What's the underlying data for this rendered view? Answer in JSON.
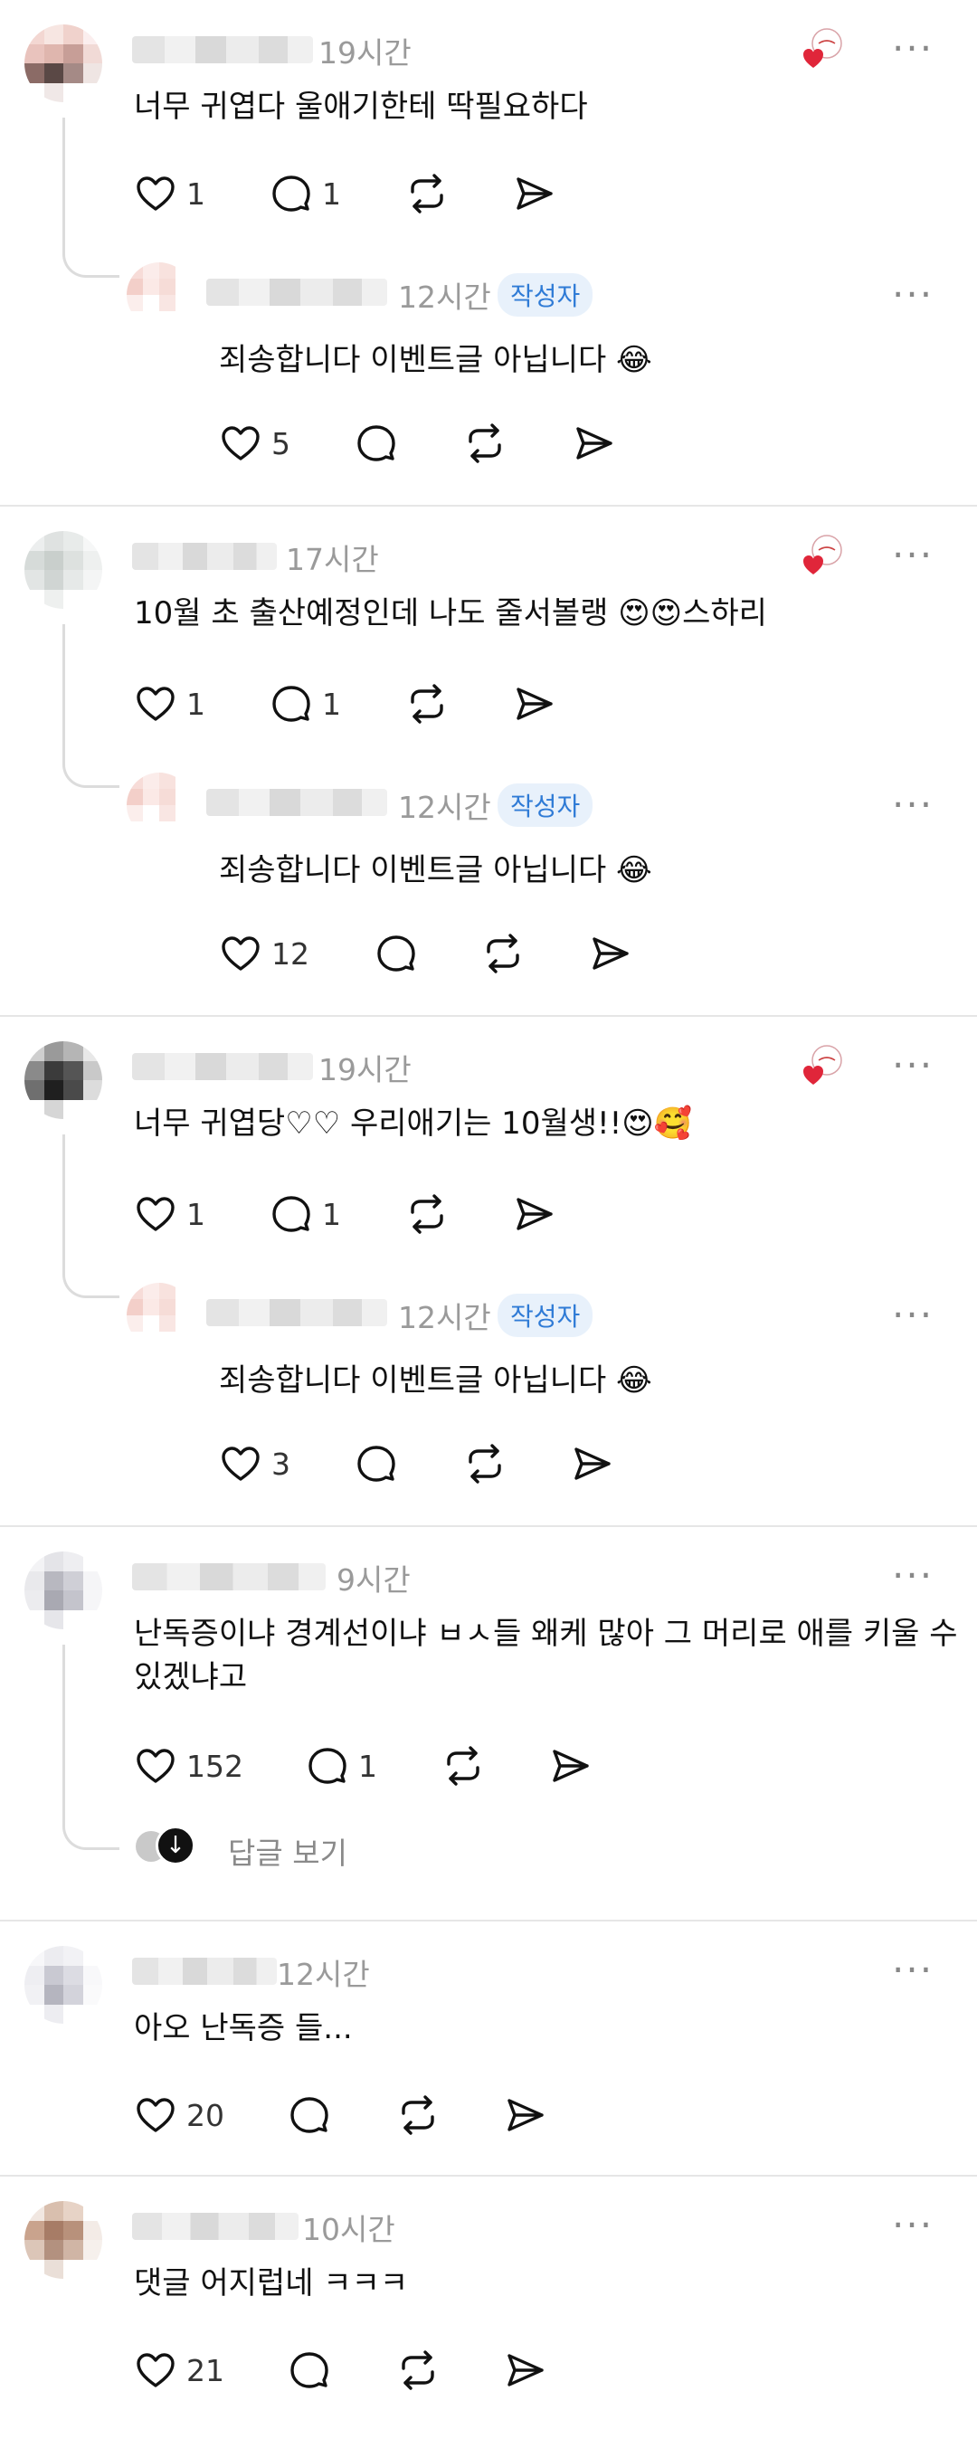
{
  "threads": [
    {
      "comment": {
        "time": "19시간",
        "text": "너무 귀엽다 울애기한테 딱필요하다",
        "likes": "1",
        "replies": "1"
      },
      "reply": {
        "time": "12시간",
        "badge": "작성자",
        "text": "죄송합니다  이벤트글 아닙니다 😂",
        "likes": "5"
      }
    },
    {
      "comment": {
        "time": "17시간",
        "text": "10월 초 출산예정인데 나도 줄서볼랭 😍😍스하리",
        "likes": "1",
        "replies": "1"
      },
      "reply": {
        "time": "12시간",
        "badge": "작성자",
        "text": "죄송합니다  이벤트글 아닙니다 😂",
        "likes": "12"
      }
    },
    {
      "comment": {
        "time": "19시간",
        "text": "너무 귀엽당♡♡ 우리애기는 10월생!!😍🥰",
        "likes": "1",
        "replies": "1"
      },
      "reply": {
        "time": "12시간",
        "badge": "작성자",
        "text": "죄송합니다  이벤트글 아닙니다 😂",
        "likes": "3"
      }
    },
    {
      "comment": {
        "time": "9시간",
        "text_line1": "난독증이냐 경계선이냐 ㅂㅅ들 왜케 많아 그 머리로 애를 키울 수",
        "text_line2": "있겠냐고",
        "likes": "152",
        "replies": "1"
      },
      "view_replies": "답글 보기"
    },
    {
      "comment": {
        "time": "12시간",
        "text": "아오 난독증 들...",
        "likes": "20"
      }
    },
    {
      "comment": {
        "time": "10시간",
        "text": "댓글 어지럽네 ㅋㅋㅋ",
        "likes": "21"
      }
    }
  ],
  "more_label": "···",
  "icons": {
    "like": "heart-icon",
    "reply": "comment-icon",
    "repost": "repost-icon",
    "share": "send-icon",
    "liked_by_author": "author-liked-heart-icon"
  },
  "colors": {
    "badge_bg": "#e8f1fb",
    "badge_text": "#2f7bd6",
    "liked_heart": "#e0263a",
    "divider": "#e6e6e6"
  }
}
